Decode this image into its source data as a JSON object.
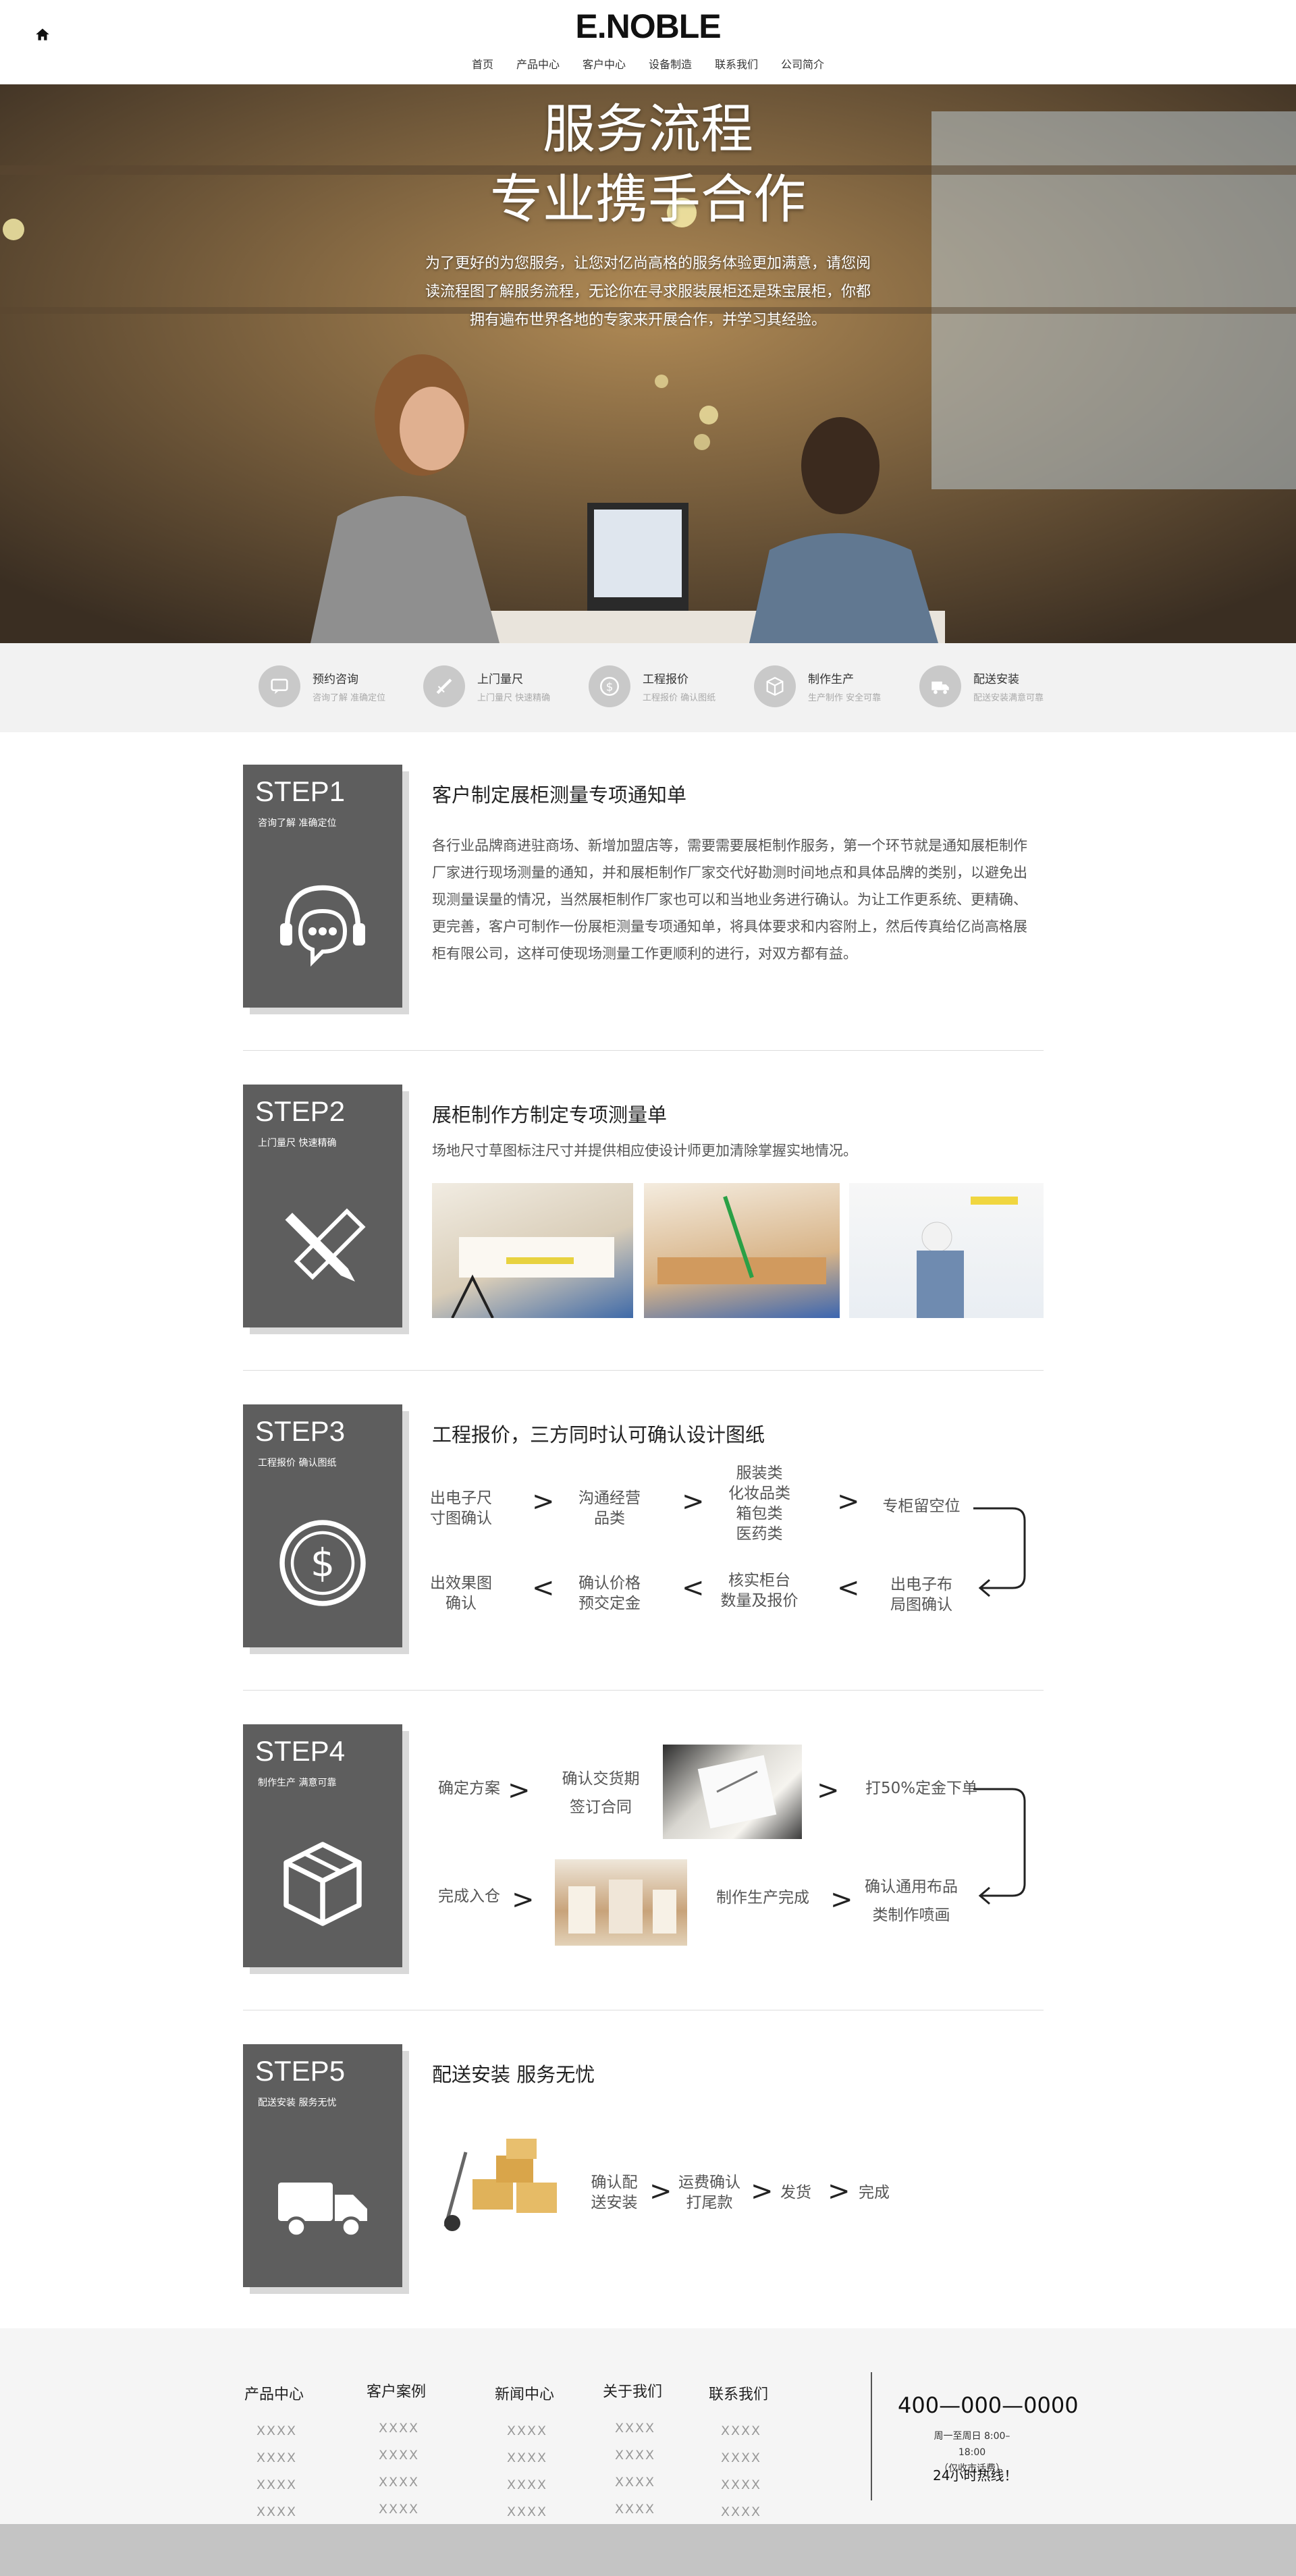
{
  "header": {
    "logo": "E.NOBLE",
    "nav": [
      "首页",
      "产品中心",
      "客户中心",
      "设备制造",
      "联系我们",
      "公司简介"
    ]
  },
  "hero": {
    "title_line1": "服务流程",
    "title_line2": "专业携手合作",
    "desc": "为了更好的为您服务，让您对亿尚高格的服务体验更加满意，请您阅读流程图了解服务流程，无论你在寻求服装展柜还是珠宝展柜，你都拥有遍布世界各地的专家来开展合作，并学习其经验。"
  },
  "process": [
    {
      "title": "预约咨询",
      "sub": "咨询了解 准确定位",
      "icon": "chat-icon"
    },
    {
      "title": "上门量尺",
      "sub": "上门量尺 快速精确",
      "icon": "ruler-icon"
    },
    {
      "title": "工程报价",
      "sub": "工程报价 确认图纸",
      "icon": "dollar-icon"
    },
    {
      "title": "制作生产",
      "sub": "生产制作 安全可靠",
      "icon": "box-icon"
    },
    {
      "title": "配送安装",
      "sub": "配送安装满意可靠",
      "icon": "truck-icon"
    }
  ],
  "steps": [
    {
      "no": "STEP1",
      "sub": "咨询了解 准确定位",
      "icon": "headset-chat-icon",
      "title": "客户制定展柜测量专项通知单",
      "text": "各行业品牌商进驻商场、新增加盟店等，需要需要展柜制作服务，第一个环节就是通知展柜制作厂家进行现场测量的通知，并和展柜制作厂家交代好勘测时间地点和具体品牌的类别，以避免出现测量误量的情况，当然展柜制作厂家也可以和当地业务进行确认。为让工作更系统、更精确、更完善，客户可制作一份展柜测量专项通知单，将具体要求和内容附上，然后传真给亿尚高格展柜有限公司，这样可使现场测量工作更顺利的进行，对双方都有益。"
    },
    {
      "no": "STEP2",
      "sub": "上门量尺 快速精确",
      "icon": "pencil-ruler-icon",
      "title": "展柜制作方制定专项测量单",
      "text": "场地尺寸草图标注尺寸并提供相应使设计师更加清除掌握实地情况。"
    },
    {
      "no": "STEP3",
      "sub": "工程报价 确认图纸",
      "icon": "dollar-coin-icon",
      "title": "工程报价，三方同时认可确认设计图纸",
      "flow_top": [
        "出电子尺\n寸图确认",
        "沟通经营\n品类",
        "服装类\n化妆品类\n箱包类\n医药类",
        "专柜留空位"
      ],
      "flow_bottom": [
        "出效果图\n确认",
        "确认价格\n预交定金",
        "核实柜台\n数量及报价",
        "出电子布\n局图确认"
      ]
    },
    {
      "no": "STEP4",
      "sub": "制作生产 满意可靠",
      "icon": "package-icon",
      "flow_top": [
        "确定方案",
        "确认交货期\n签订合同",
        "打50%定金下单"
      ],
      "flow_bottom": [
        "完成入仓",
        "制作生产完成",
        "确认通用布品\n类制作喷画"
      ]
    },
    {
      "no": "STEP5",
      "sub": "配送安装 服务无忧",
      "icon": "delivery-truck-icon",
      "title": "配送安装 服务无忧",
      "flow": [
        "确认配\n送安装",
        "运费确认\n打尾款",
        "发货",
        "完成"
      ]
    }
  ],
  "footer": {
    "columns": [
      {
        "head": "产品中心",
        "links": [
          "XXXX",
          "XXXX",
          "XXXX",
          "XXXX"
        ]
      },
      {
        "head": "客户案例",
        "links": [
          "XXXX",
          "XXXX",
          "XXXX",
          "XXXX"
        ]
      },
      {
        "head": "新闻中心",
        "links": [
          "XXXX",
          "XXXX",
          "XXXX",
          "XXXX"
        ]
      },
      {
        "head": "关于我们",
        "links": [
          "XXXX",
          "XXXX",
          "XXXX",
          "XXXX"
        ]
      },
      {
        "head": "联系我们",
        "links": [
          "XXXX",
          "XXXX",
          "XXXX",
          "XXXX"
        ]
      }
    ],
    "phone": "400—000—0000",
    "hours_line1": "周一至周日 8:00–18:00",
    "hours_line2": "（仅收市话费）",
    "hotline": "24小时热线！"
  },
  "colors": {
    "step_box": "#5e5e5e",
    "process_bg": "#f2f2f2",
    "footer_bg": "#f5f5f5",
    "bottom_bar": "#c4c4c4"
  }
}
